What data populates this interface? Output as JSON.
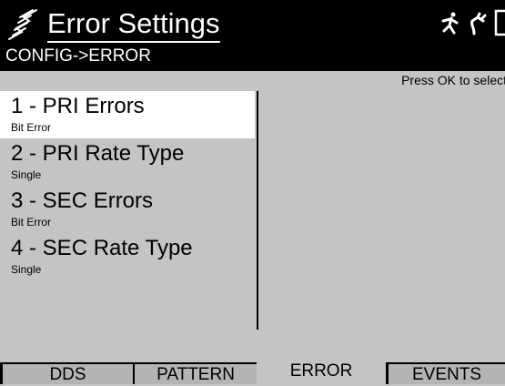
{
  "header": {
    "title": "Error Settings",
    "breadcrumb": "CONFIG->ERROR",
    "title_icon": "lightning-icon",
    "status_icons": [
      "running-person-icon",
      "power-plug-icon",
      "battery-icon"
    ]
  },
  "hint": "Press OK to select",
  "menu": {
    "items": [
      {
        "label": "1 - PRI Errors",
        "value": "Bit Error",
        "selected": true
      },
      {
        "label": "2 - PRI Rate Type",
        "value": "Single",
        "selected": false
      },
      {
        "label": "3 - SEC Errors",
        "value": "Bit Error",
        "selected": false
      },
      {
        "label": "4 - SEC Rate Type",
        "value": "Single",
        "selected": false
      }
    ]
  },
  "tabs": [
    {
      "label": "DDS",
      "active": false
    },
    {
      "label": "PATTERN",
      "active": false
    },
    {
      "label": "ERROR",
      "active": true
    },
    {
      "label": "EVENTS",
      "active": false
    }
  ],
  "colors": {
    "header_bg": "#000000",
    "panel_bg": "#c4c4c4",
    "selected_bg": "#ffffff",
    "inactive_tab_bg": "#b4b4b4"
  }
}
